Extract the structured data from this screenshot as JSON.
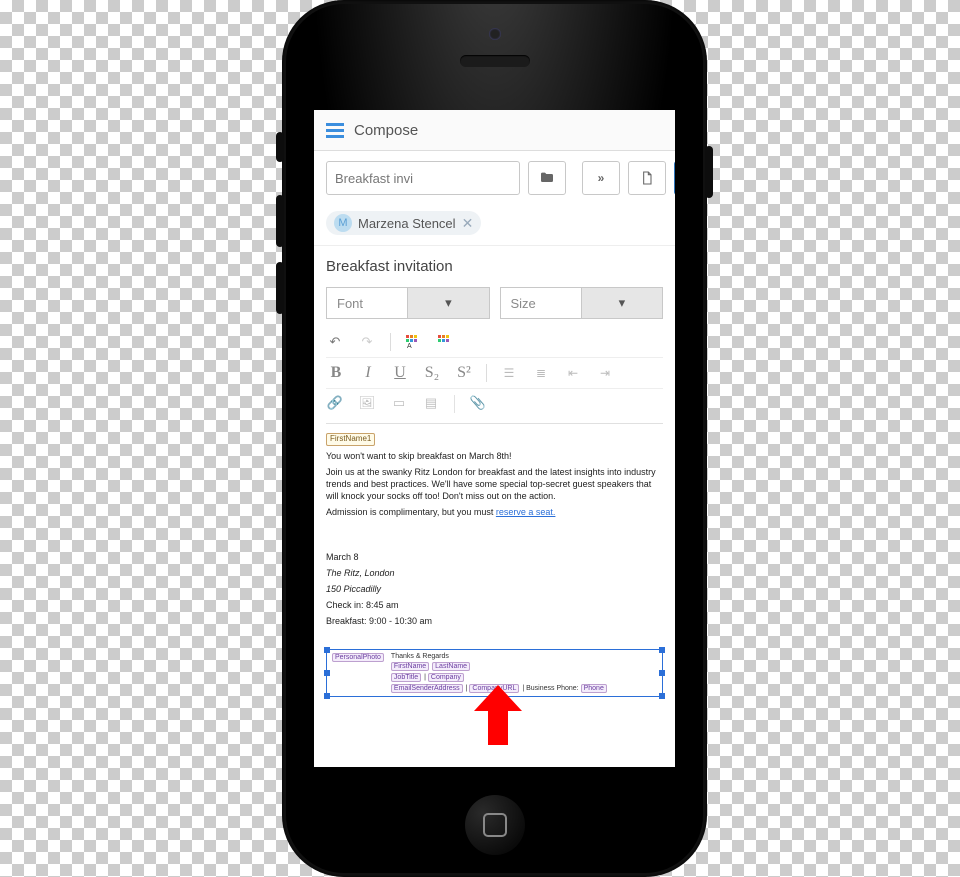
{
  "header": {
    "title": "Compose"
  },
  "toolbar": {
    "subject_preview": "Breakfast invi"
  },
  "recipient": {
    "avatar_initial": "M",
    "name": "Marzena Stencel",
    "remove_glyph": "✕"
  },
  "subject": "Breakfast invitation",
  "editor": {
    "font_label": "Font",
    "size_label": "Size",
    "dropdown_glyph": "▾",
    "undo_glyph": "↶",
    "redo_glyph": "↷",
    "bold": "B",
    "italic": "I",
    "underline": "U",
    "sub": "S₂",
    "sup": "S²",
    "attach_glyph": "📎"
  },
  "body": {
    "token_firstname": "FirstName1",
    "line1": "You won't want to skip breakfast on March 8th!",
    "line2": "Join us at the swanky Ritz London for breakfast and the latest insights into industry trends and best practices. We'll have some special top-secret guest speakers that will knock your socks off too! Don't miss out on the action.",
    "line3_pre": "Admission is complimentary, but you must ",
    "line3_link": "reserve a seat.",
    "date": "March 8",
    "venue": "The Ritz, London",
    "address": "150 Piccadilly",
    "checkin": "Check in: 8:45 am",
    "breakfast": "Breakfast: 9:00 - 10:30 am"
  },
  "signature": {
    "greeting": "Thanks & Regards",
    "tokens": {
      "personal_photo": "PersonalPhoto",
      "first_name": "FirstName",
      "last_name": "LastName",
      "job_title": "JobTitle",
      "company": "Company",
      "email": "EmailSenderAddress",
      "company_url": "CompanyURL",
      "phone": "Phone"
    },
    "biz_phone_label": "Business Phone:"
  }
}
